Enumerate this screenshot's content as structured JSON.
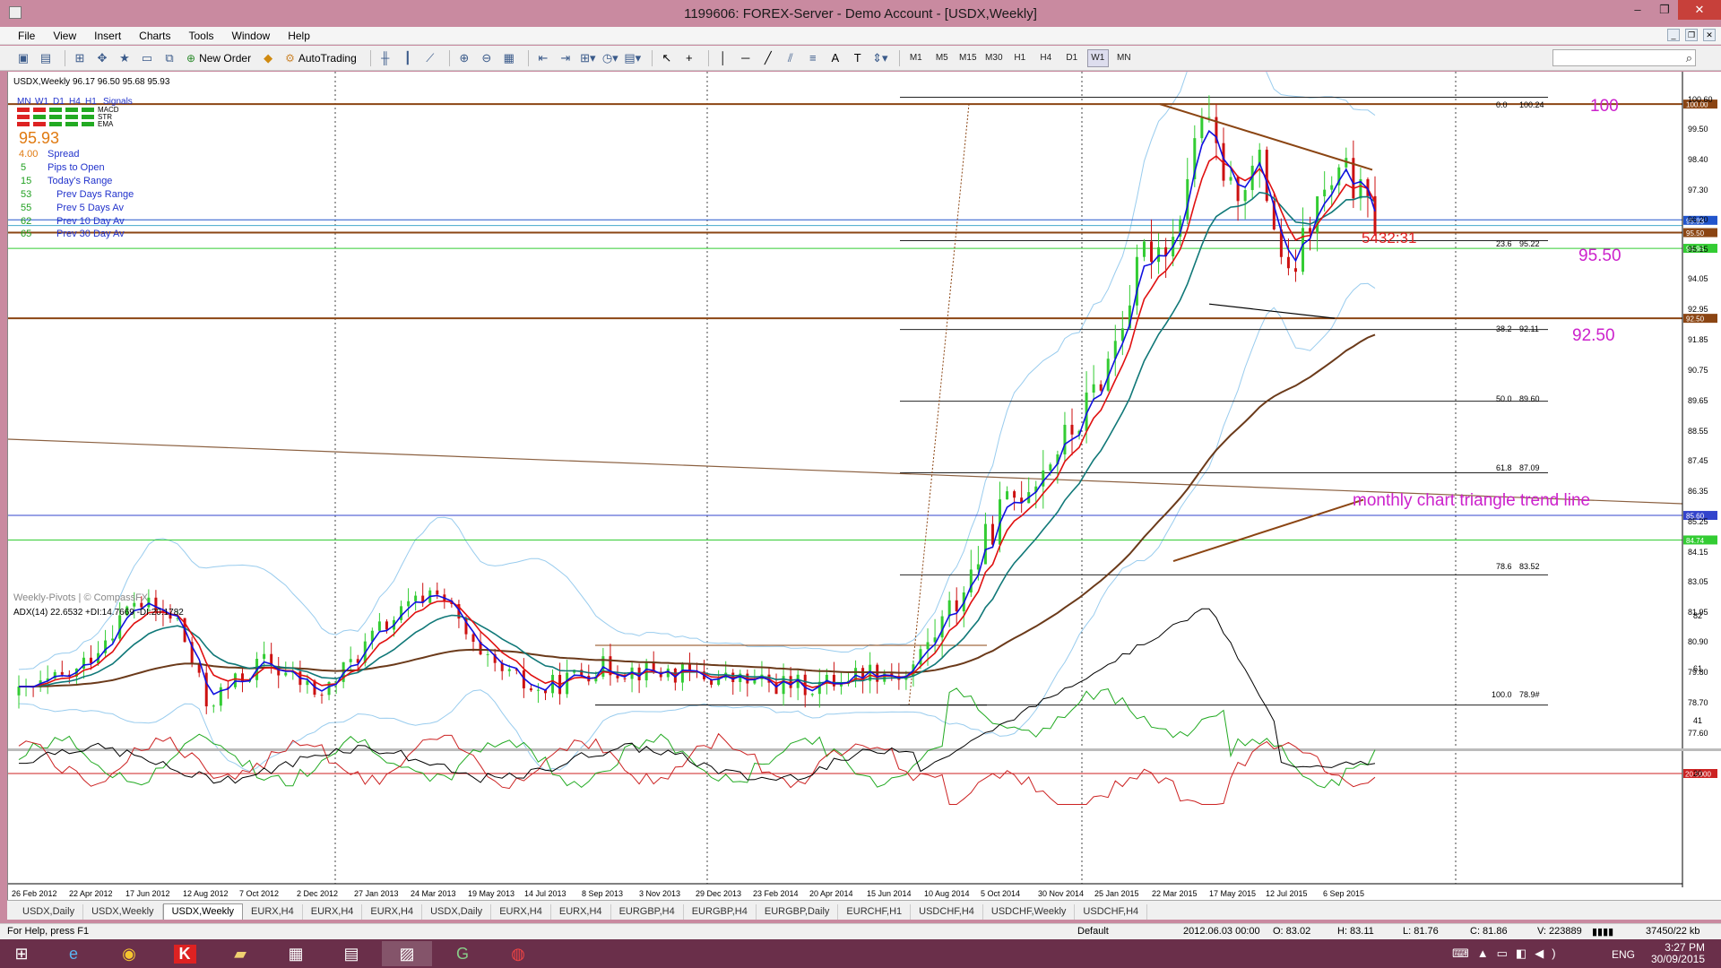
{
  "window": {
    "title": "1199606: FOREX-Server - Demo Account - [USDX,Weekly]",
    "controls": [
      "–",
      "❐",
      "✕"
    ],
    "mdi_controls": [
      "_",
      "❐",
      "✕"
    ]
  },
  "menu": [
    "File",
    "View",
    "Insert",
    "Charts",
    "Tools",
    "Window",
    "Help"
  ],
  "toolbar": {
    "new_order_label": "New Order",
    "autotrading_label": "AutoTrading",
    "timeframes": [
      "M1",
      "M5",
      "M15",
      "M30",
      "H1",
      "H4",
      "D1",
      "W1",
      "MN"
    ]
  },
  "chart": {
    "header": "USDX,Weekly  96.17 96.50 95.68 95.93",
    "watermark": "Weekly-Pivots | © CompassFX",
    "signals_panel": {
      "timeframes": [
        "MN",
        "W1",
        "D1",
        "H4",
        "H1"
      ],
      "signals_label": "Signals",
      "indicators": [
        "MACD",
        "STR",
        "EMA"
      ],
      "price": "95.93",
      "spread": "4.00",
      "spread_label": "Spread",
      "rows": [
        {
          "value": "5",
          "label": "Pips to Open"
        },
        {
          "value": "15",
          "label": "Today's Range"
        },
        {
          "value": "53",
          "label": "Prev Days Range"
        },
        {
          "value": "55",
          "label": "Prev 5 Days Av"
        },
        {
          "value": "62",
          "label": "Prev 10 Day Av"
        },
        {
          "value": "65",
          "label": "Prev 30 Day Av"
        }
      ]
    },
    "fib_levels": [
      {
        "pct": "0.0",
        "price": "100.24"
      },
      {
        "pct": "23.6",
        "price": "95.22"
      },
      {
        "pct": "38.2",
        "price": "92.11"
      },
      {
        "pct": "50.0",
        "price": "89.60"
      },
      {
        "pct": "61.8",
        "price": "87.09"
      },
      {
        "pct": "78.6",
        "price": "83.52"
      },
      {
        "pct": "100.0",
        "price": "78.9#"
      }
    ],
    "annotations": {
      "level_100": "100",
      "level_9550": "95.50",
      "level_9250": "92.50",
      "timer": "5432:31",
      "trendline_label": "monthly chart triangle trend line"
    },
    "price_axis": [
      "100.60",
      "99.50",
      "98.40",
      "97.30",
      "96.20",
      "95.15",
      "94.05",
      "92.95",
      "91.85",
      "90.75",
      "89.65",
      "88.55",
      "87.45",
      "86.35",
      "85.25",
      "84.15",
      "83.05",
      "81.95",
      "80.90",
      "79.80",
      "78.70",
      "77.60"
    ],
    "price_tags": [
      {
        "label": "100.00",
        "bg": "#8b4513"
      },
      {
        "label": "95.93",
        "bg": "#2255cc"
      },
      {
        "label": "95.50",
        "bg": "#8b4513"
      },
      {
        "label": "94.95",
        "bg": "#33cc33"
      },
      {
        "label": "92.50",
        "bg": "#8b4513"
      },
      {
        "label": "85.60",
        "bg": "#3344cc"
      },
      {
        "label": "84.74",
        "bg": "#33cc33"
      }
    ],
    "date_axis": [
      "26 Feb 2012",
      "22 Apr 2012",
      "17 Jun 2012",
      "12 Aug 2012",
      "7 Oct 2012",
      "2 Dec 2012",
      "27 Jan 2013",
      "24 Mar 2013",
      "19 May 2013",
      "14 Jul 2013",
      "8 Sep 2013",
      "3 Nov 2013",
      "29 Dec 2013",
      "23 Feb 2014",
      "20 Apr 2014",
      "15 Jun 2014",
      "10 Aug 2014",
      "5 Oct 2014",
      "30 Nov 2014",
      "25 Jan 2015",
      "22 Mar 2015",
      "17 May 2015",
      "12 Jul 2015",
      "6 Sep 2015"
    ],
    "adx": {
      "header": "ADX(14) 22.6532 +DI:14.7669 -DI:20.1782",
      "axis": [
        "82",
        "61",
        "41",
        "20"
      ],
      "level_tag": "20.0000"
    }
  },
  "tabs": [
    "USDX,Daily",
    "USDX,Weekly",
    "USDX,Weekly",
    "EURX,H4",
    "EURX,H4",
    "EURX,H4",
    "USDX,Daily",
    "EURX,H4",
    "EURX,H4",
    "EURGBP,H4",
    "EURGBP,H4",
    "EURGBP,Daily",
    "EURCHF,H1",
    "USDCHF,H4",
    "USDCHF,Weekly",
    "USDCHF,H4"
  ],
  "active_tab_index": 2,
  "status": {
    "help": "For Help, press F1",
    "profile": "Default",
    "datetime": "2012.06.03 00:00",
    "open": "O: 83.02",
    "high": "H: 83.11",
    "low": "L: 81.76",
    "close": "C: 81.86",
    "volume": "V: 223889",
    "traffic": "37450/22 kb"
  },
  "taskbar": {
    "lang": "ENG",
    "time": "3:27 PM",
    "date": "30/09/2015"
  },
  "colors": {
    "resistance_brown": "#8b4513",
    "signal_magenta": "#cc22cc",
    "ema_red": "#e01010",
    "ema_blue": "#1010e0",
    "ema_teal": "#107878",
    "bull_candle": "#33cc33",
    "bear_candle": "#cc1111"
  }
}
